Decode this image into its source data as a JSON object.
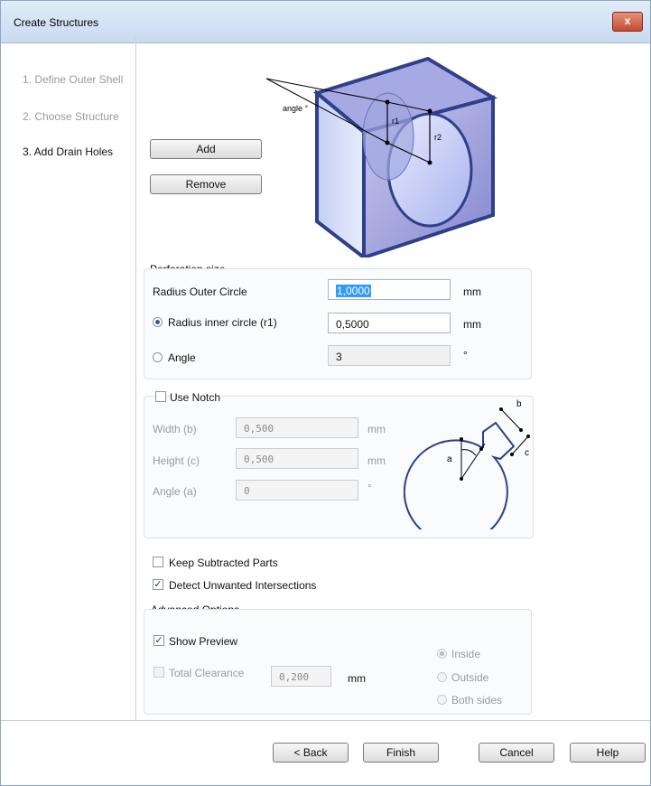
{
  "window": {
    "title": "Create Structures",
    "close_label": "x"
  },
  "steps": [
    {
      "label": "1. Define Outer Shell"
    },
    {
      "label": "2. Choose Structure"
    },
    {
      "label": "3. Add Drain Holes"
    }
  ],
  "actions": {
    "add_label": "Add",
    "remove_label": "Remove"
  },
  "diagram": {
    "angle_label": "angle °",
    "r1_label": "r1",
    "r2_label": "r2"
  },
  "perforation": {
    "title": "Perforation size",
    "radius_outer_label": "Radius Outer Circle",
    "radius_outer_value": "1,0000",
    "radius_outer_unit": "mm",
    "radius_inner_label": "Radius inner circle (r1)",
    "radius_inner_value": "0,5000",
    "radius_inner_unit": "mm",
    "angle_label": "Angle",
    "angle_value": "3",
    "angle_unit": "°",
    "selected_mode": "radius_inner"
  },
  "notch": {
    "use_label": "Use Notch",
    "checked": false,
    "width_label": "Width (b)",
    "width_value": "0,500",
    "width_unit": "mm",
    "height_label": "Height (c)",
    "height_value": "0,500",
    "height_unit": "mm",
    "angle_label": "Angle (a)",
    "angle_value": "0",
    "angle_unit": "°",
    "diagram": {
      "a": "a",
      "b": "b",
      "c": "c"
    }
  },
  "options": {
    "keep_label": "Keep Subtracted Parts",
    "keep_checked": false,
    "detect_label": "Detect Unwanted Intersections",
    "detect_checked": true
  },
  "advanced": {
    "title": "Advanced Options",
    "show_preview_label": "Show Preview",
    "show_preview_checked": true,
    "total_clearance_label": "Total Clearance",
    "total_clearance_checked": false,
    "clearance_value": "0,200",
    "clearance_unit": "mm",
    "side_options": [
      "Inside",
      "Outside",
      "Both sides"
    ],
    "side_selected": "Inside"
  },
  "footer": {
    "back_label": "< Back",
    "finish_label": "Finish",
    "cancel_label": "Cancel",
    "help_label": "Help"
  },
  "colors": {
    "shape_fill": "#8f90d8",
    "shape_edge": "#2f3f8a",
    "title_gradient_top": "#e2ecf8"
  }
}
